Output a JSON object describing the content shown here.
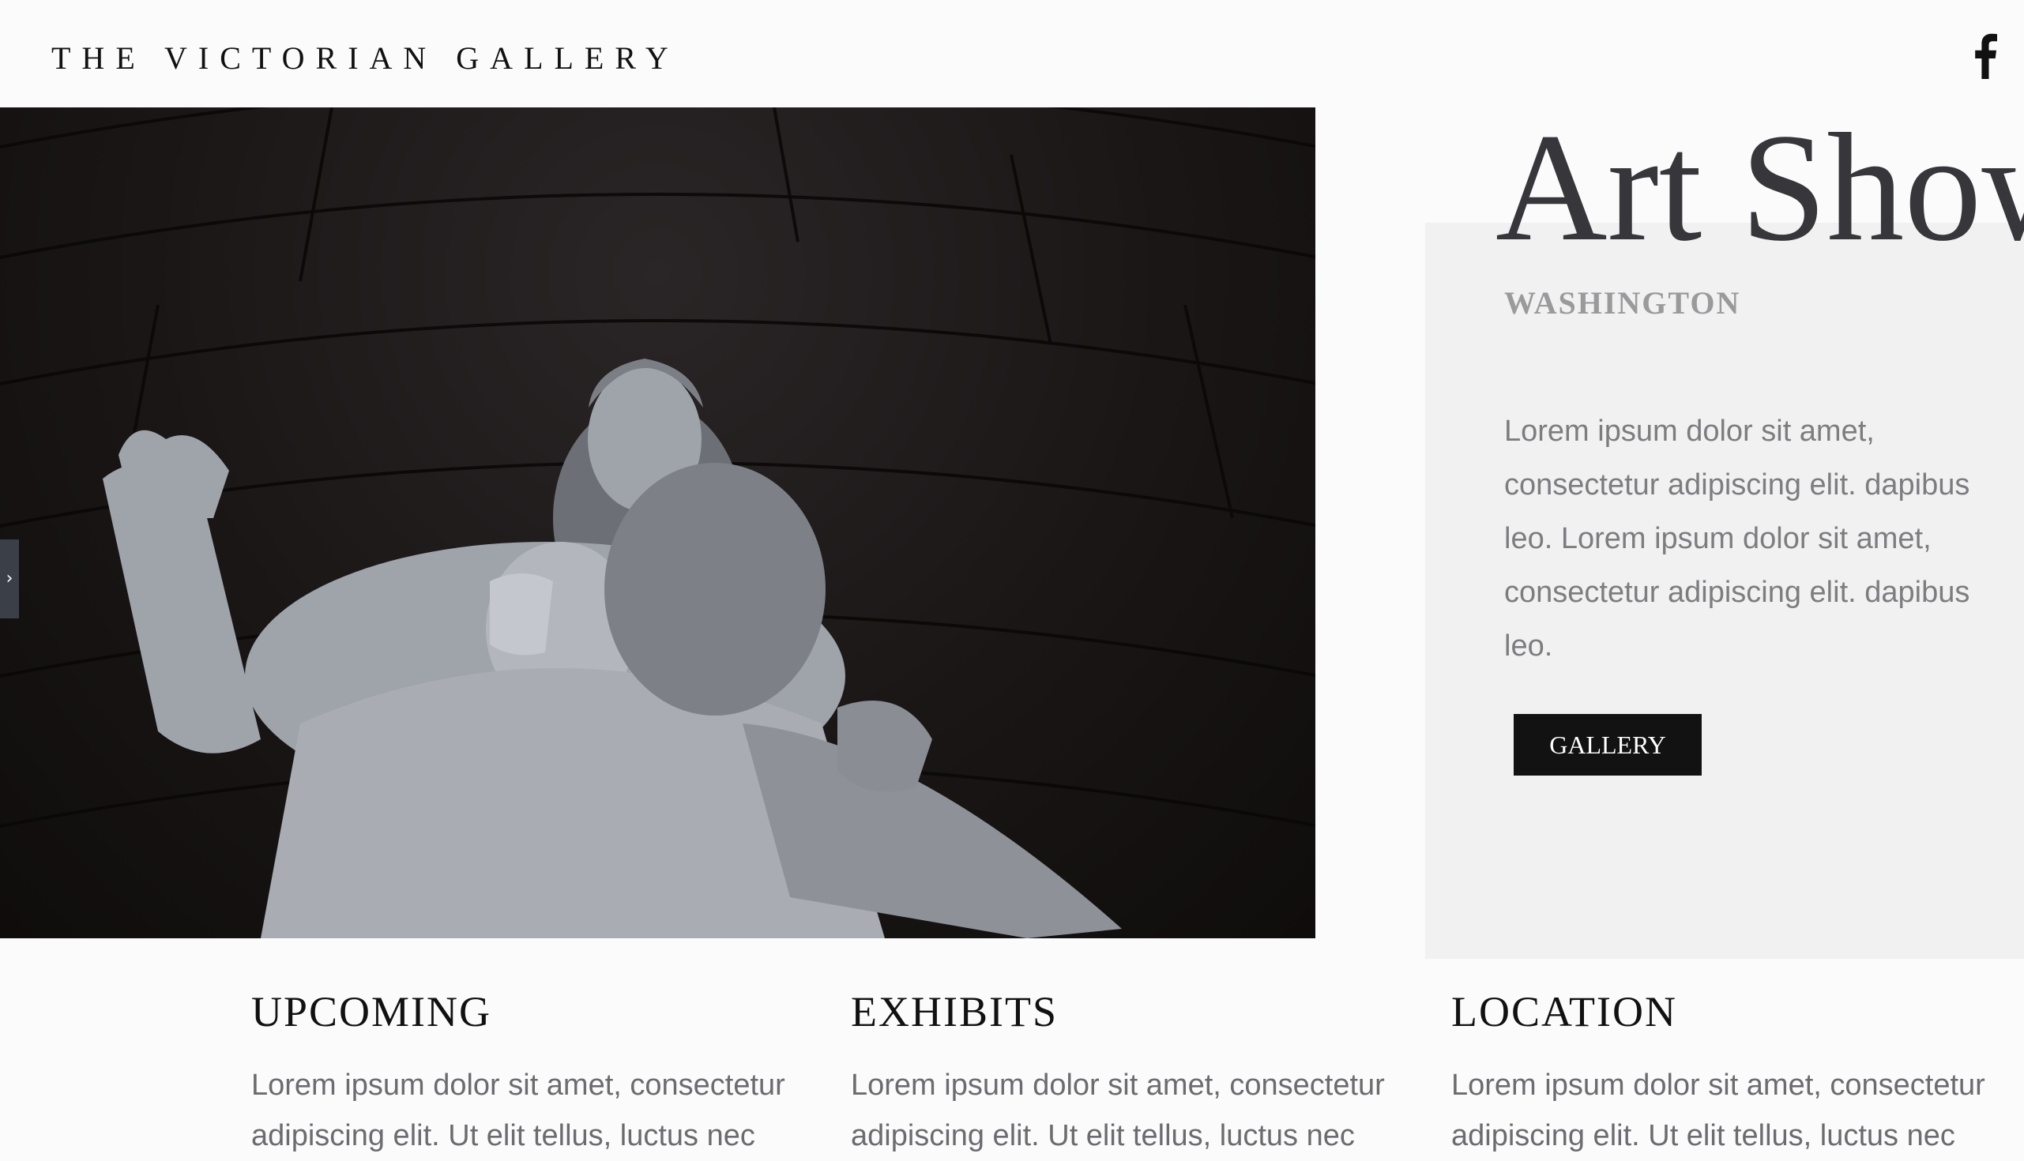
{
  "header": {
    "site_title": "THE VICTORIAN GALLERY",
    "social_icon": "facebook-icon"
  },
  "hero": {
    "image_subject": "marble-statue",
    "slider_arrow": "›"
  },
  "feature": {
    "title": "Art Show",
    "city": "WASHINGTON",
    "description": "Lorem ipsum dolor sit amet, consectetur adipiscing elit.  dapibus leo. Lorem ipsum dolor sit amet, consectetur adipiscing elit.  dapibus leo.",
    "button_label": "GALLERY"
  },
  "columns": [
    {
      "heading": "UPCOMING",
      "text": "Lorem ipsum dolor sit amet, consectetur adipiscing elit. Ut elit tellus, luctus nec"
    },
    {
      "heading": "EXHIBITS",
      "text": "Lorem ipsum dolor sit amet, consectetur adipiscing elit. Ut elit tellus, luctus nec"
    },
    {
      "heading": "LOCATION",
      "text": "Lorem ipsum dolor sit amet, consectetur adipiscing elit. Ut elit tellus, luctus nec"
    }
  ],
  "colors": {
    "page_background": "#fbfbfc",
    "panel_background": "#f1f1f2",
    "button_background": "#121212",
    "heading_text": "#111111",
    "body_text": "#6c6c70"
  }
}
